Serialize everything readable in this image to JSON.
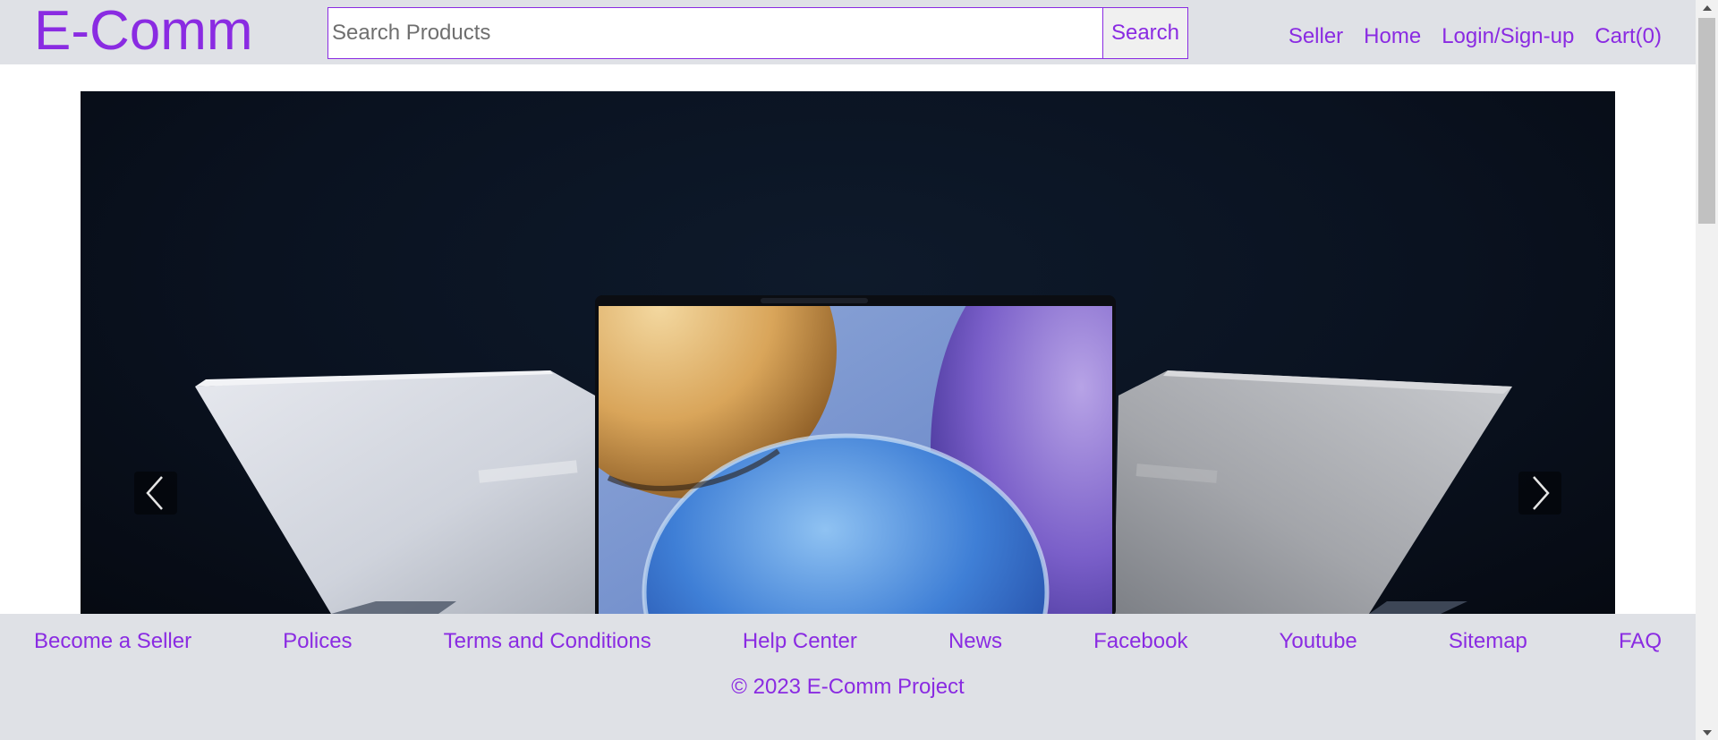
{
  "header": {
    "logo": "E-Comm",
    "search": {
      "placeholder": "Search Products",
      "value": "",
      "button_label": "Search"
    },
    "nav": {
      "seller": "Seller",
      "home": "Home",
      "login": "Login/Sign-up",
      "cart": "Cart(0)"
    }
  },
  "carousel": {
    "slide_content": "laptops-image",
    "prev_icon": "chevron-left-icon",
    "next_icon": "chevron-right-icon"
  },
  "footer": {
    "links": {
      "become_seller": "Become a Seller",
      "policies": "Polices",
      "terms": "Terms and Conditions",
      "help": "Help Center",
      "news": "News",
      "facebook": "Facebook",
      "youtube": "Youtube",
      "sitemap": "Sitemap",
      "faq": "FAQ"
    },
    "copyright": "© 2023 E-Comm Project"
  },
  "theme": {
    "accent": "#8a2be2",
    "bar_background": "#dfe1e6"
  }
}
